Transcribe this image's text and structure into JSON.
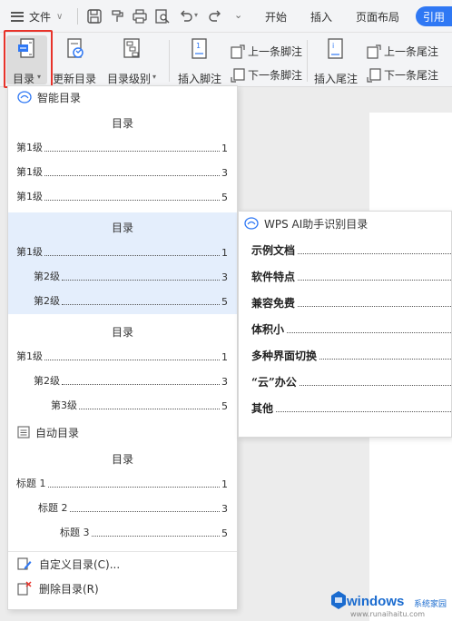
{
  "titlebar": {
    "file_label": "文件",
    "tabs": [
      "开始",
      "插入",
      "页面布局"
    ],
    "active_tab": "引用"
  },
  "ribbon": {
    "toc_label": "目录",
    "update_toc_label": "更新目录",
    "toc_level_label": "目录级别",
    "insert_footnote_label": "插入脚注",
    "prev_footnote_label": "上一条脚注",
    "next_footnote_label": "下一条脚注",
    "insert_endnote_label": "插入尾注",
    "prev_endnote_label": "上一条尾注",
    "next_endnote_label": "下一条尾注"
  },
  "dropdown": {
    "smart_toc_header": "智能目录",
    "auto_toc_header": "自动目录",
    "template1": {
      "title": "目录",
      "lines": [
        {
          "text": "第1级",
          "page": "1"
        },
        {
          "text": "第1级",
          "page": "3"
        },
        {
          "text": "第1级",
          "page": "5"
        }
      ]
    },
    "template2": {
      "title": "目录",
      "lines": [
        {
          "text": "第1级",
          "page": "1"
        },
        {
          "text": "第2级",
          "page": "3"
        },
        {
          "text": "第2级",
          "page": "5"
        }
      ]
    },
    "template3": {
      "title": "目录",
      "lines": [
        {
          "text": "第1级",
          "page": "1"
        },
        {
          "text": "第2级",
          "page": "3"
        },
        {
          "text": "第3级",
          "page": "5"
        }
      ]
    },
    "template4": {
      "title": "目录",
      "lines": [
        {
          "text": "标题 1",
          "page": "1"
        },
        {
          "text": "标题 2",
          "page": "3"
        },
        {
          "text": "标题 3",
          "page": "5"
        }
      ]
    },
    "custom_toc": "自定义目录(C)...",
    "delete_toc": "删除目录(R)"
  },
  "ai_panel": {
    "header": "WPS AI助手识别目录",
    "items": [
      "示例文档",
      "软件特点",
      "兼容免费",
      "体积小",
      "多种界面切换",
      "“云”办公",
      "其他"
    ]
  },
  "watermark": {
    "brand": "windows",
    "sub": "系统家园",
    "url": "www.runaihaitu.com"
  },
  "colors": {
    "accent": "#2f78f4",
    "highlight": "#e4eefc",
    "red_box": "#e8332a"
  }
}
